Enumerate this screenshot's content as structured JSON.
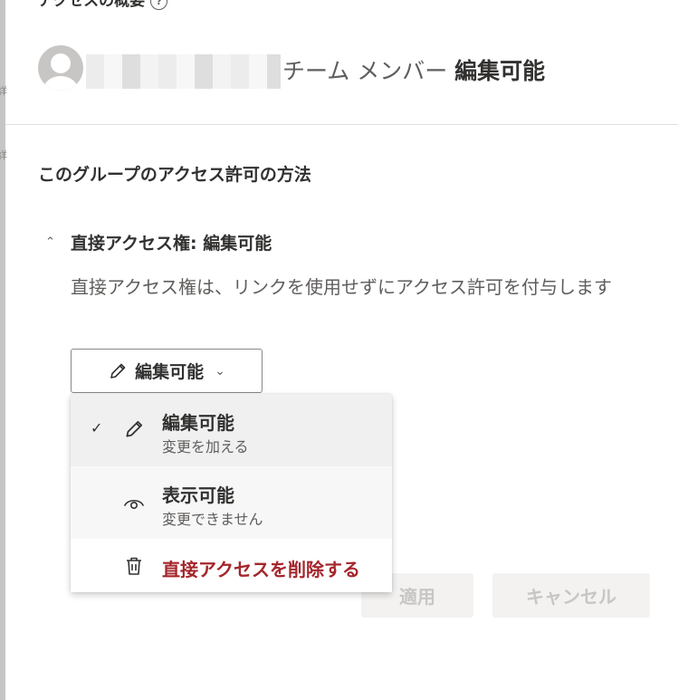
{
  "header": {
    "title": "アクセスの概要",
    "info_glyph": "?"
  },
  "left_rail": {
    "chars": [
      "詳",
      "詳"
    ]
  },
  "member": {
    "role": "チーム メンバー",
    "permission": "編集可能"
  },
  "section": {
    "title": "このグループのアクセス許可の方法"
  },
  "direct_access": {
    "label": "直接アクセス権: 編集可能",
    "description": "直接アクセス権は、リンクを使用せずにアクセス許可を付与します",
    "dropdown_value": "編集可能"
  },
  "menu": {
    "items": [
      {
        "title": "編集可能",
        "subtitle": "変更を加える",
        "icon": "pencil-icon",
        "checked": true
      },
      {
        "title": "表示可能",
        "subtitle": "変更できません",
        "icon": "eye-icon",
        "checked": false
      },
      {
        "title": "直接アクセスを削除する",
        "icon": "trash-icon",
        "color": "#a4262c"
      }
    ]
  },
  "footer": {
    "apply_label": "適用",
    "cancel_label": "キャンセル"
  }
}
